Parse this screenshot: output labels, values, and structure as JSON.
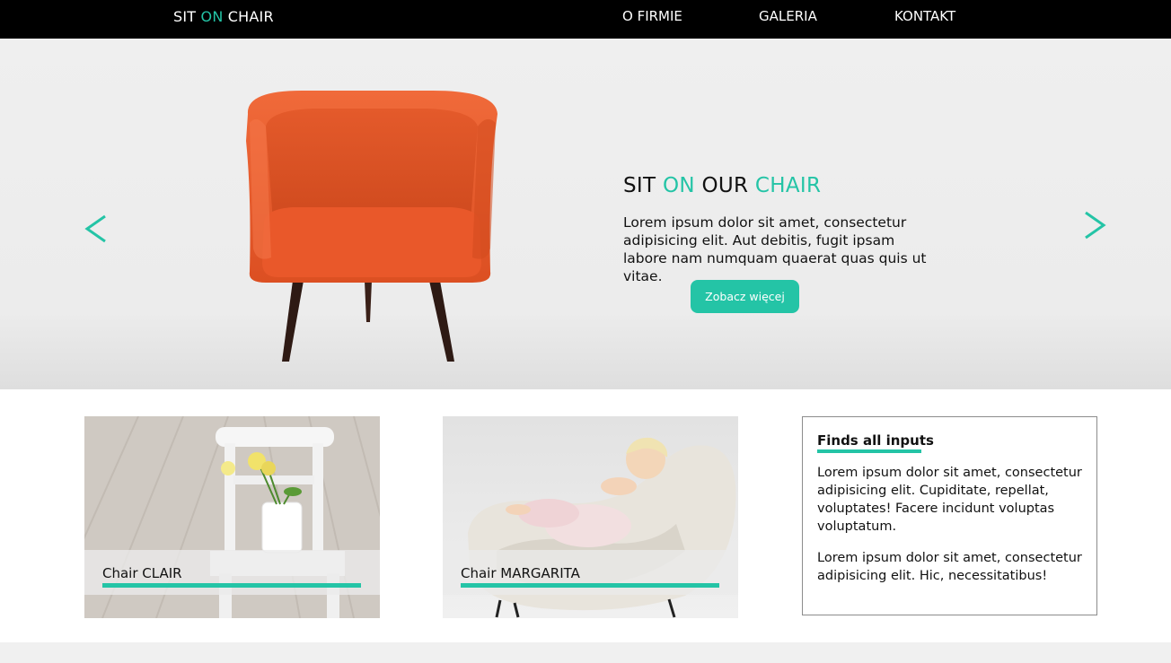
{
  "nav": {
    "logo": {
      "part1": "SIT ",
      "part2": "ON",
      "part3": " CHAIR"
    },
    "items": [
      {
        "label": "O FIRMIE"
      },
      {
        "label": "GALERIA"
      },
      {
        "label": "KONTAKT"
      }
    ]
  },
  "hero": {
    "title": {
      "part1": "SIT ",
      "part2": "ON",
      "part3": " OUR ",
      "part4": "CHAIR"
    },
    "text": "Lorem ipsum dolor sit amet, consectetur adipisicing elit. Aut debitis, fugit ipsam labore nam numquam quaerat quas quis ut vitae.",
    "button_label": "Zobacz więcej",
    "prev_icon": "chevron-left-icon",
    "next_icon": "chevron-right-icon"
  },
  "cards": [
    {
      "title": "Chair CLAIR"
    },
    {
      "title": "Chair MARGARITA"
    }
  ],
  "info": {
    "title": "Finds all inputs",
    "p1": "Lorem ipsum dolor sit amet, consectetur adipisicing elit. Cupiditate, repellat, voluptates! Facere incidunt voluptas voluptatum.",
    "p2": "Lorem ipsum dolor sit amet, consectetur adipisicing elit. Hic, necessitatibus!"
  },
  "colors": {
    "accent": "#24c4a6",
    "nav_bg": "#000000",
    "hero_bg": "#ececec"
  }
}
